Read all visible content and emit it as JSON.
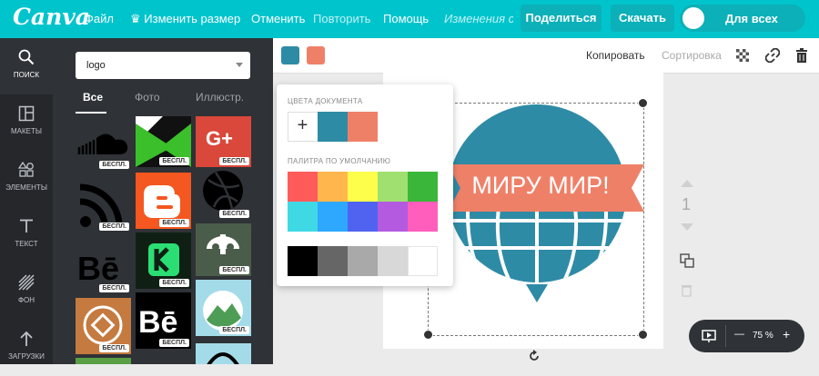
{
  "topbar": {
    "logo": "Canva",
    "menu": {
      "file": "Файл",
      "resize": "Изменить размер",
      "undo": "Отменить",
      "redo": "Повторить",
      "help": "Помощь",
      "saving": "Изменения сохр..."
    },
    "share_label": "Поделиться",
    "download_label": "Скачать",
    "toggle_label": "Для всех",
    "accent": "#00c4cc"
  },
  "leftnav": {
    "items": [
      {
        "label": "ПОИСК",
        "icon": "search-icon"
      },
      {
        "label": "МАКЕТЫ",
        "icon": "layout-icon"
      },
      {
        "label": "ЭЛЕМЕНТЫ",
        "icon": "elements-icon"
      },
      {
        "label": "ТЕКСТ",
        "icon": "text-icon"
      },
      {
        "label": "ФОН",
        "icon": "background-icon"
      },
      {
        "label": "ЗАГРУЗКИ",
        "icon": "upload-icon"
      }
    ]
  },
  "panel": {
    "search_value": "logo",
    "tabs": [
      "Все",
      "Фото",
      "Иллюстр."
    ],
    "badge": "БЕСПЛ."
  },
  "editor_toolbar": {
    "copy_label": "Копировать",
    "sort_label": "Сортировка",
    "swatch_colors": [
      "#2e8ba6",
      "#ef8068"
    ]
  },
  "color_popup": {
    "doc_colors_title": "ЦВЕТА ДОКУМЕНТА",
    "add_symbol": "+",
    "doc_colors": [
      "#2e8ba6",
      "#ef8068"
    ],
    "palette_title": "ПАЛИТРА ПО УМОЛЧАНИЮ",
    "palette": [
      "#ff5b5b",
      "#ffb74d",
      "#fdfd4b",
      "#a0e070",
      "#3ab73a",
      "#3fd9e6",
      "#2ea8ff",
      "#5063f0",
      "#b45ae0",
      "#ff5ebc",
      "#000000",
      "#666666",
      "#a9a9a9",
      "#d8d8d8",
      "#ffffff"
    ]
  },
  "canvas": {
    "banner_text": "МИРУ МИР!",
    "page_number": "1",
    "globe_color": "#2e8ba6",
    "banner_color": "#ef8068"
  },
  "zoom": {
    "minus": "—",
    "value": "75 %",
    "plus": "+"
  }
}
